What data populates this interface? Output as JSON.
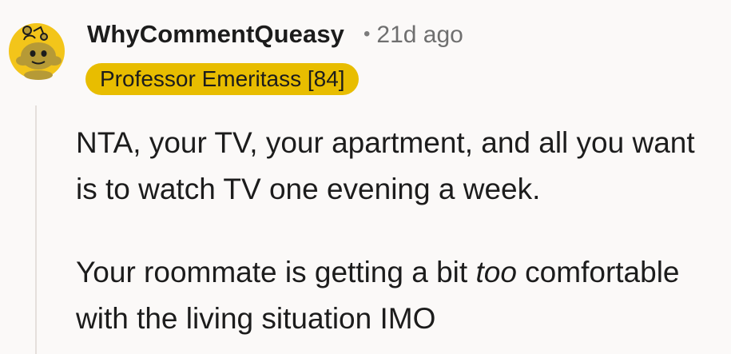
{
  "comment": {
    "username": "WhyCommentQueasy",
    "separator": "•",
    "timestamp": "21d ago",
    "flair": "Professor Emeritass [84]",
    "paragraph_1": "NTA, your TV, your apartment, and all you want is to watch TV one evening a week.",
    "paragraph_2_before": "Your roommate is getting a bit ",
    "paragraph_2_emphasis": "too",
    "paragraph_2_after": " comfortable with the living situation IMO"
  },
  "colors": {
    "background": "#fbf9f8",
    "flair_background": "#e8bd00",
    "avatar_yellow": "#f3c51a",
    "avatar_snoo": "#b69a36",
    "text": "#1c1c1c",
    "muted_text": "#6f6f6f"
  },
  "icons": {
    "avatar": "reddit-snoo-avatar-icon"
  }
}
